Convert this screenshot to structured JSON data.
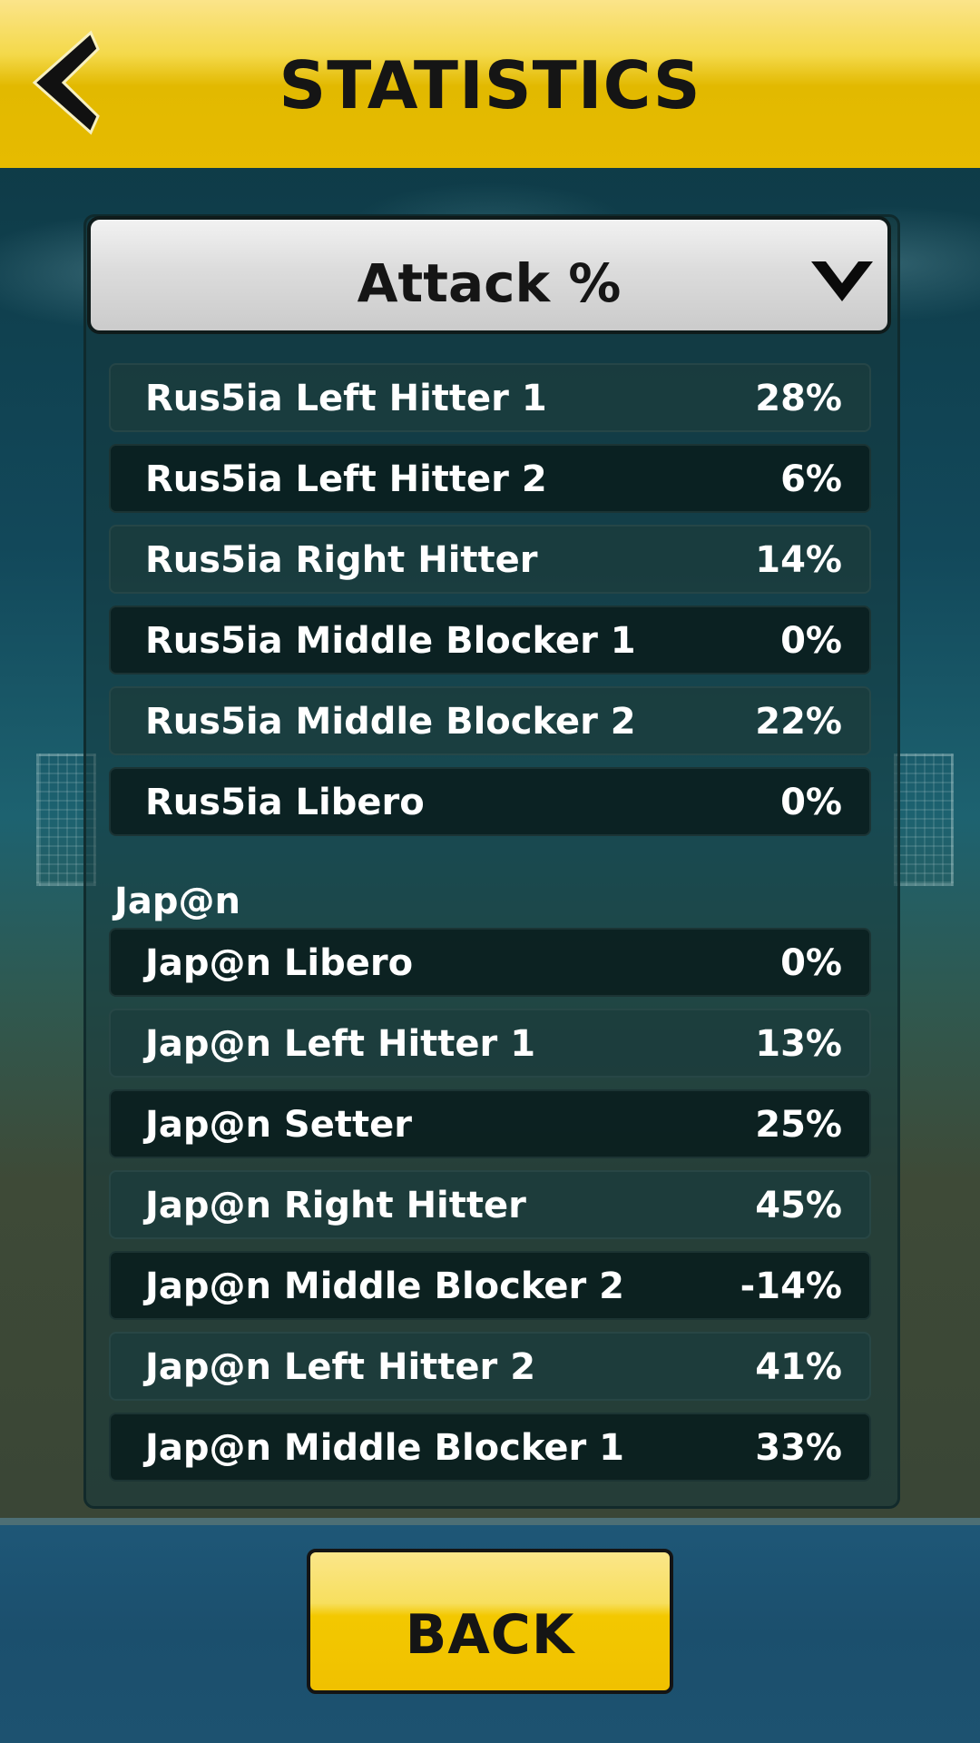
{
  "header": {
    "title": "STATISTICS",
    "back_icon": "chevron-left-icon"
  },
  "stat_selector": {
    "selected": "Attack %",
    "icon": "chevron-down-icon"
  },
  "team1": {
    "players": [
      {
        "name": "Rus5ia Left Hitter 1",
        "value": "28%"
      },
      {
        "name": "Rus5ia Left Hitter 2",
        "value": "6%"
      },
      {
        "name": "Rus5ia Right Hitter",
        "value": "14%"
      },
      {
        "name": "Rus5ia Middle Blocker 1",
        "value": "0%"
      },
      {
        "name": "Rus5ia Middle Blocker 2",
        "value": "22%"
      },
      {
        "name": "Rus5ia Libero",
        "value": "0%"
      }
    ]
  },
  "team2": {
    "name": "Jap@n",
    "players": [
      {
        "name": "Jap@n Libero",
        "value": "0%"
      },
      {
        "name": "Jap@n Left Hitter 1",
        "value": "13%"
      },
      {
        "name": "Jap@n Setter",
        "value": "25%"
      },
      {
        "name": "Jap@n Right Hitter",
        "value": "45%"
      },
      {
        "name": "Jap@n Middle Blocker 2",
        "value": "-14%"
      },
      {
        "name": "Jap@n Left Hitter 2",
        "value": "41%"
      },
      {
        "name": "Jap@n Middle Blocker 1",
        "value": "33%"
      }
    ]
  },
  "footer": {
    "back_label": "BACK"
  },
  "colors": {
    "header_yellow": "#e6bb00",
    "button_yellow": "#f3c800",
    "text_white": "#ffffff",
    "text_dark": "#151515"
  }
}
